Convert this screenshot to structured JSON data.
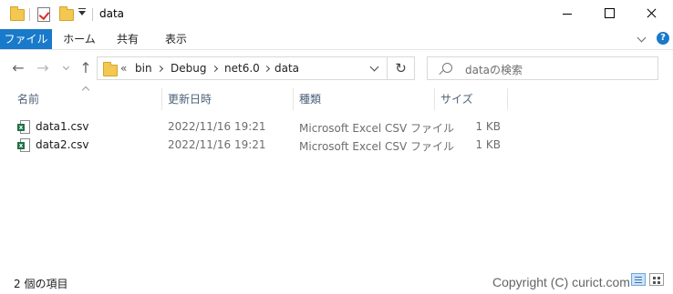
{
  "window": {
    "title": "data"
  },
  "ribbon": {
    "tabs": [
      {
        "label": "ファイル"
      },
      {
        "label": "ホーム"
      },
      {
        "label": "共有"
      },
      {
        "label": "表示"
      }
    ],
    "help_label": "?"
  },
  "nav": {
    "back": "←",
    "forward": "→",
    "up": "↑",
    "overflow": "«",
    "breadcrumb": [
      "bin",
      "Debug",
      "net6.0",
      "data"
    ],
    "refresh": "↻",
    "search_placeholder": "dataの検索"
  },
  "columns": {
    "name": "名前",
    "modified": "更新日時",
    "type": "種類",
    "size": "サイズ"
  },
  "files": [
    {
      "name": "data1.csv",
      "modified": "2022/11/16 19:21",
      "type": "Microsoft Excel CSV ファイル",
      "size": "1 KB",
      "icon": "excel-csv-icon"
    },
    {
      "name": "data2.csv",
      "modified": "2022/11/16 19:21",
      "type": "Microsoft Excel CSV ファイル",
      "size": "1 KB",
      "icon": "excel-csv-icon"
    }
  ],
  "status": {
    "item_count": "2 個の項目"
  },
  "watermark": "Copyright (C) curict.com",
  "colors": {
    "accent": "#1979ca",
    "folder": "#f3c850",
    "excel": "#1e7145",
    "header_text": "#4c607a"
  }
}
